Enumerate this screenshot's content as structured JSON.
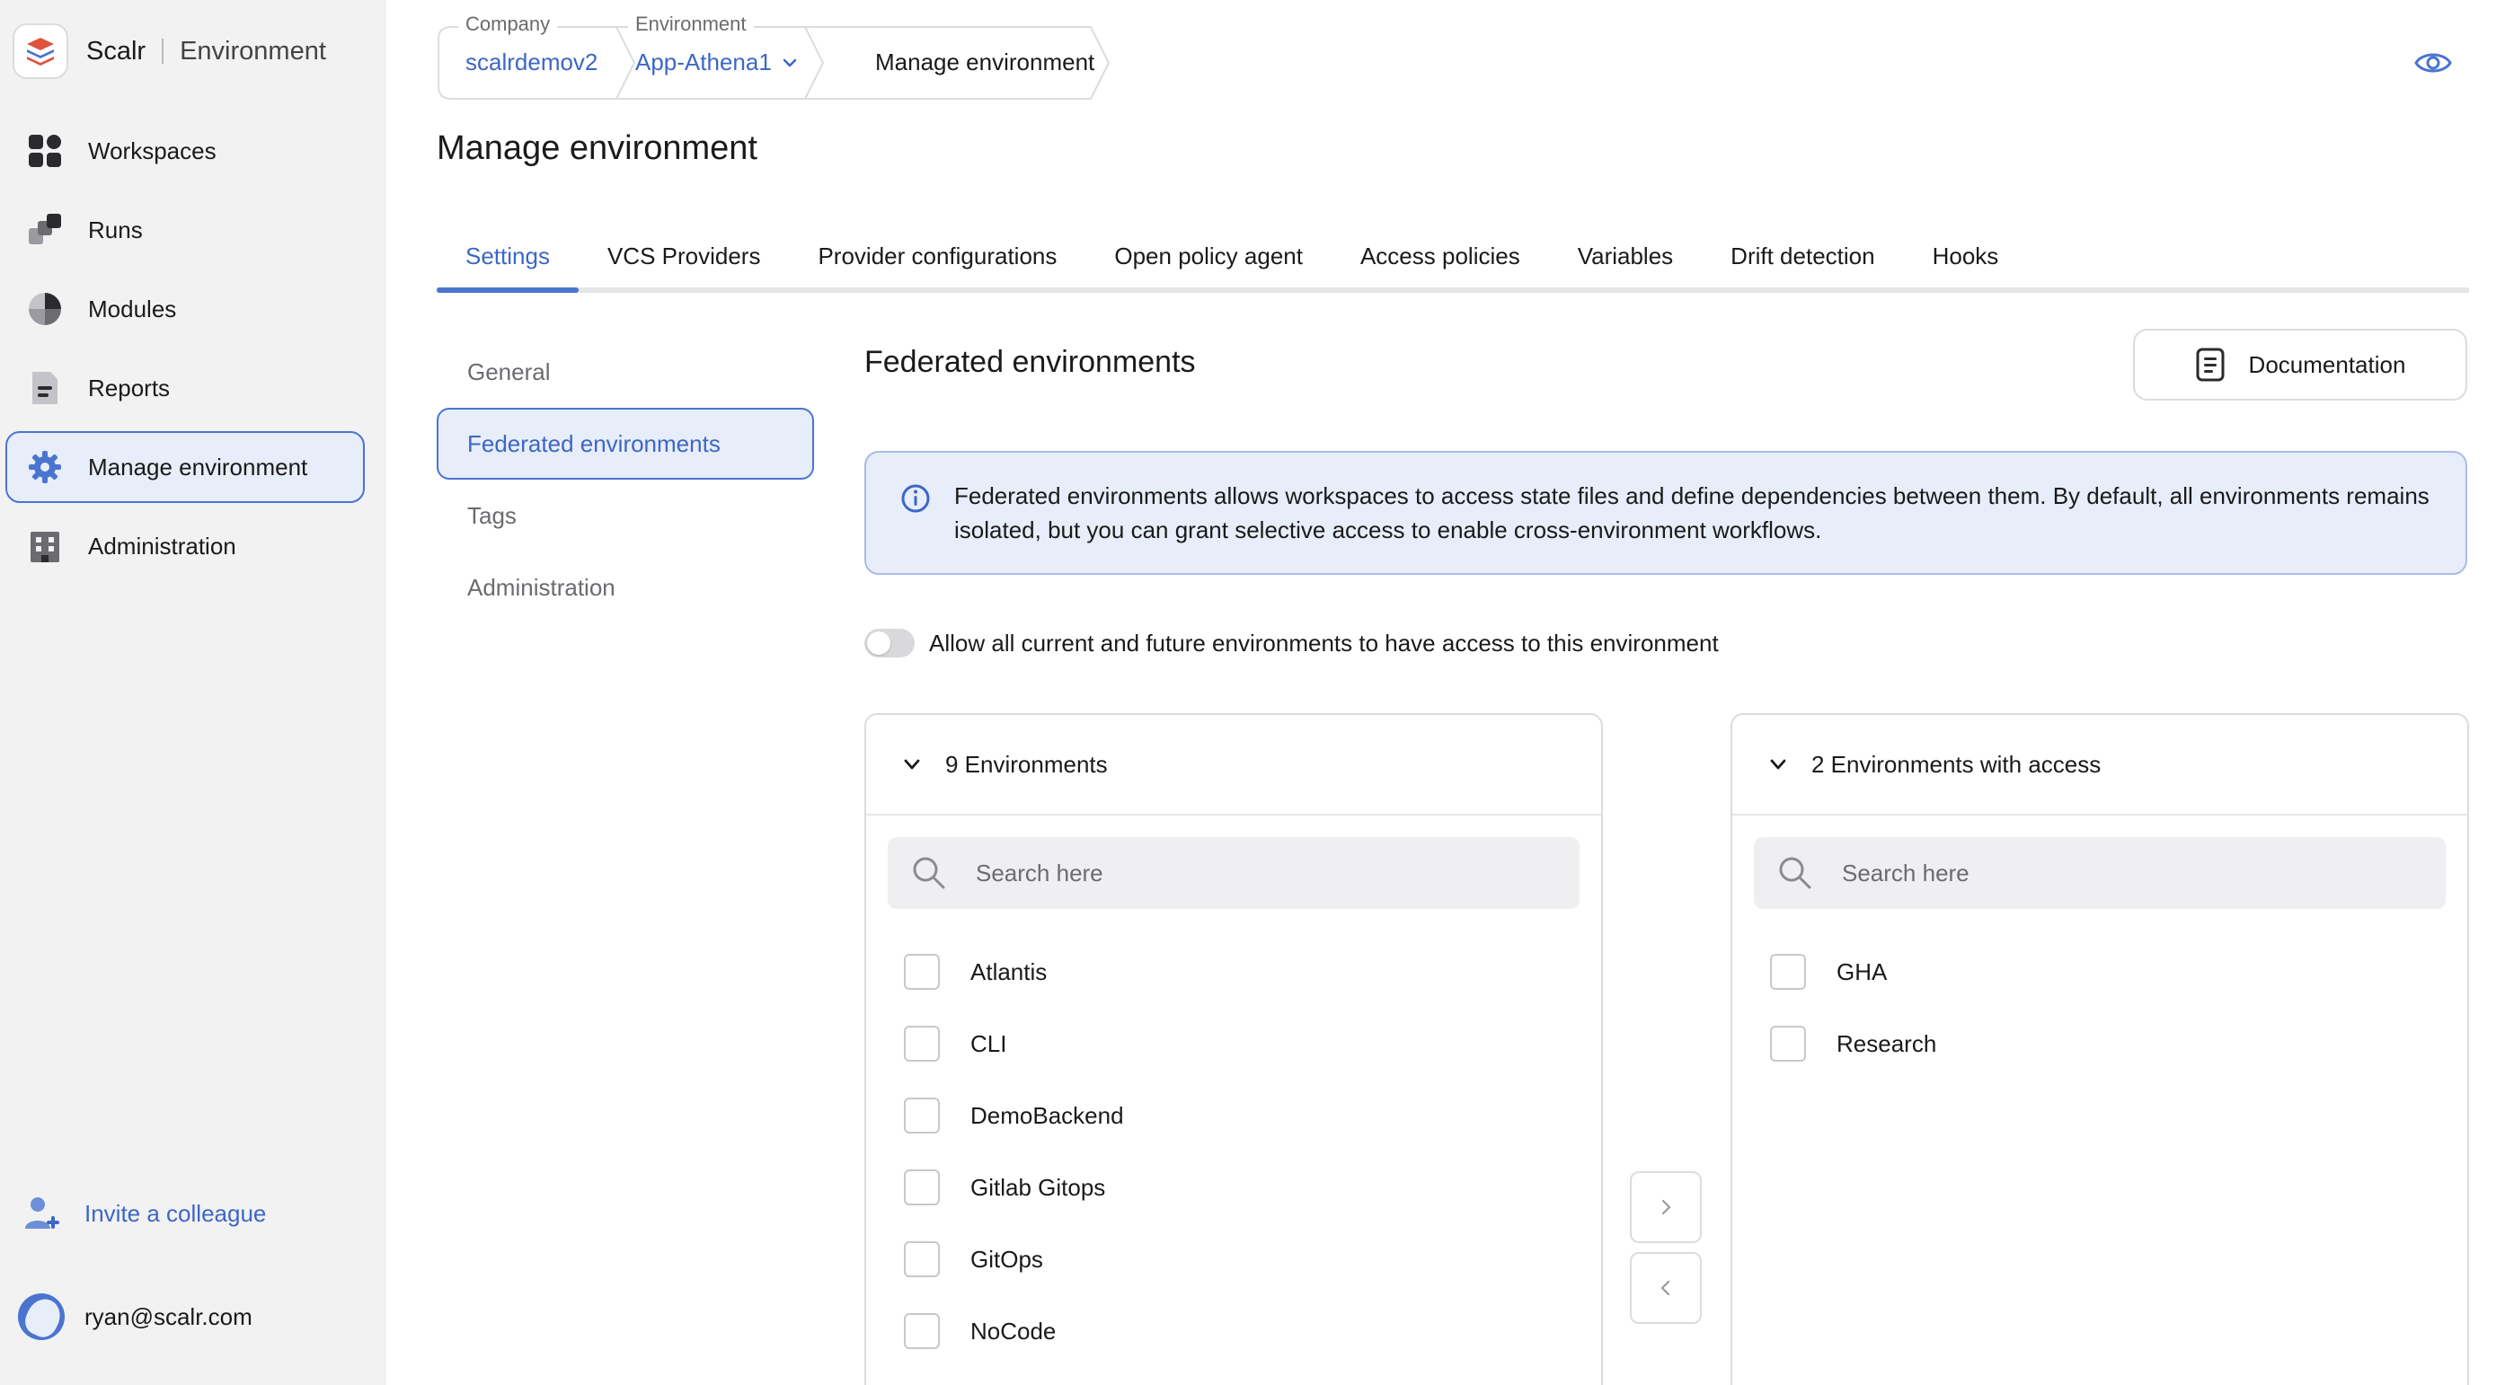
{
  "sidebar": {
    "brand_name": "Scalr",
    "context": "Environment",
    "items": [
      {
        "label": "Workspaces"
      },
      {
        "label": "Runs"
      },
      {
        "label": "Modules"
      },
      {
        "label": "Reports"
      },
      {
        "label": "Manage environment",
        "active": true
      },
      {
        "label": "Administration"
      }
    ],
    "invite_label": "Invite a colleague",
    "user_email": "ryan@scalr.com"
  },
  "breadcrumb": {
    "company_label": "Company",
    "company_value": "scalrdemov2",
    "environment_label": "Environment",
    "environment_value": "App-Athena1",
    "current": "Manage environment"
  },
  "page": {
    "title": "Manage environment"
  },
  "tabs": [
    {
      "label": "Settings",
      "active": true
    },
    {
      "label": "VCS Providers"
    },
    {
      "label": "Provider configurations"
    },
    {
      "label": "Open policy agent"
    },
    {
      "label": "Access policies"
    },
    {
      "label": "Variables"
    },
    {
      "label": "Drift detection"
    },
    {
      "label": "Hooks"
    }
  ],
  "subnav": [
    {
      "label": "General"
    },
    {
      "label": "Federated environments",
      "active": true
    },
    {
      "label": "Tags"
    },
    {
      "label": "Administration"
    }
  ],
  "content": {
    "title": "Federated environments",
    "doc_button": "Documentation",
    "info_line1": "Federated environments allows workspaces to access state files and define dependencies between them. By default, all environments remains",
    "info_line2": "isolated, but you can grant selective access to enable cross-environment workflows.",
    "toggle_label": "Allow all current and future environments to have access to this environment",
    "toggle_on": false
  },
  "left_panel": {
    "header": "9 Environments",
    "search_placeholder": "Search here",
    "items": [
      "Atlantis",
      "CLI",
      "DemoBackend",
      "Gitlab Gitops",
      "GitOps",
      "NoCode"
    ]
  },
  "right_panel": {
    "header": "2 Environments with access",
    "search_placeholder": "Search here",
    "items": [
      "GHA",
      "Research"
    ]
  },
  "colors": {
    "accent": "#4a74cf",
    "link": "#3d67c4",
    "sidebar_bg": "#f2f2f3",
    "info_bg": "#e7edf9"
  }
}
